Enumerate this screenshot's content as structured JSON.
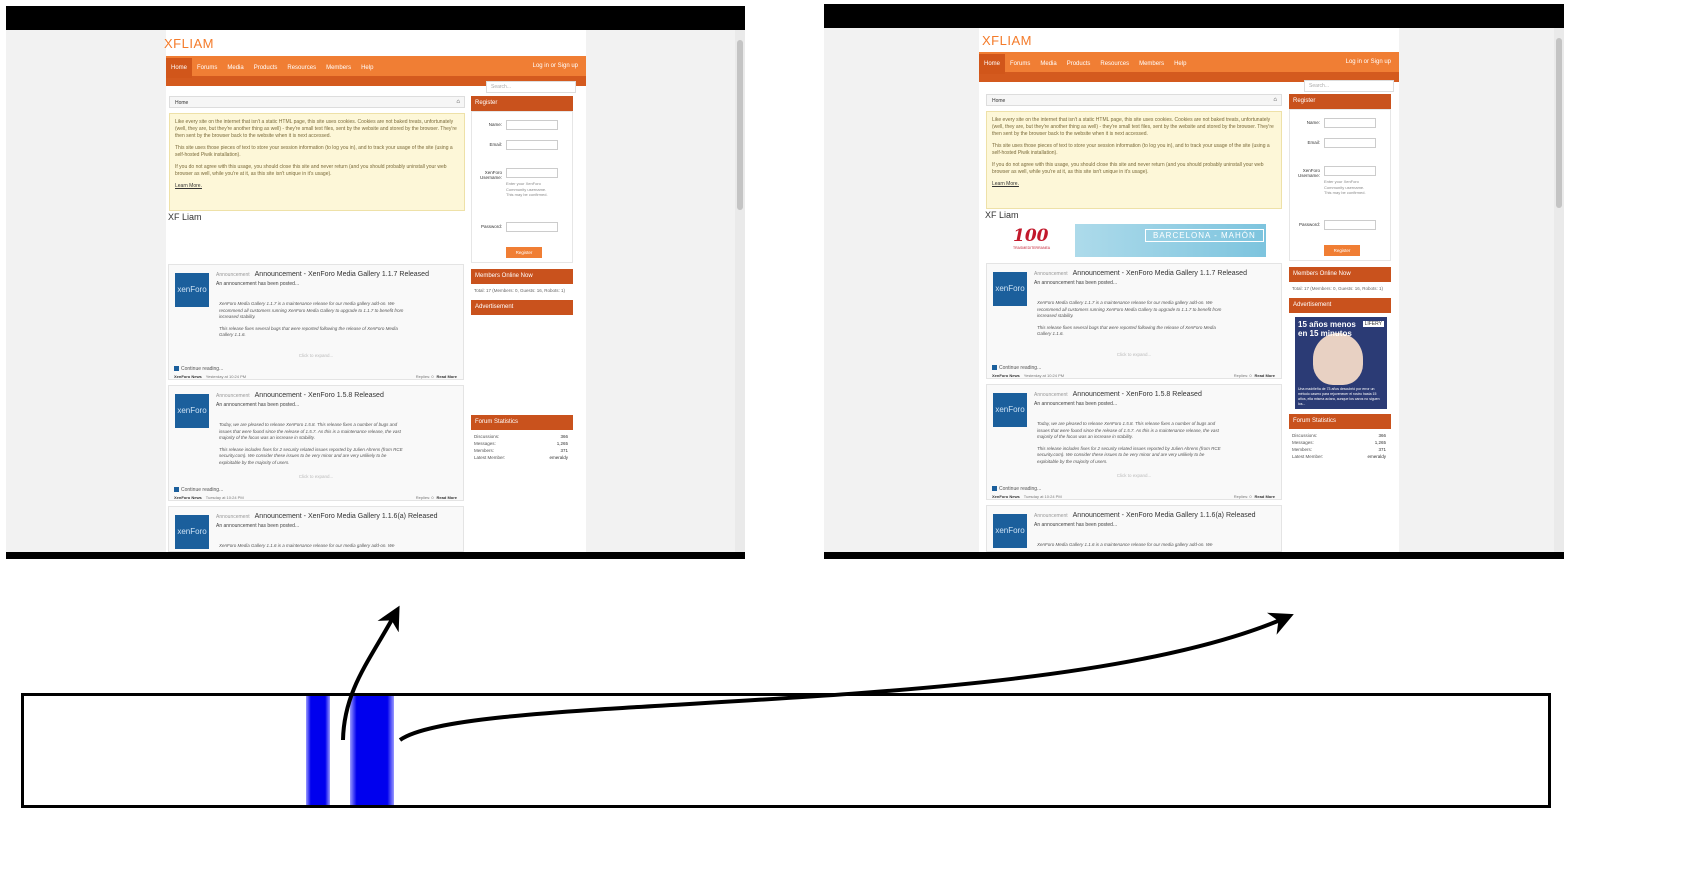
{
  "screenshots": [
    {
      "id": "left",
      "logo": "XFLIAM",
      "nav_tabs": [
        "Home",
        "Forums",
        "Media",
        "Products",
        "Resources",
        "Members",
        "Help"
      ],
      "login": "Log in or Sign up",
      "search_placeholder": "Search...",
      "breadcrumb": "Home",
      "notice": [
        "Like every site on the internet that isn't a static HTML page, this site uses cookies. Cookies are not baked treats, unfortunately (well, they are, but they're another thing as well) - they're small text files, sent by the website and stored by the browser. They're then sent by the browser back to the website when it is next accessed.",
        "This site uses those pieces of text to store your session information (to log you in), and to track your usage of the site (using a self-hosted Piwik installation).",
        "If you do not agree with this usage, you should close this site and never return (and you should probably uninstall your web browser as well, while you're at it, as this site isn't unique in it's usage)."
      ],
      "learn_more": "Learn More.",
      "site_title": "XF Liam",
      "show_banner": false,
      "show_ad": false
    },
    {
      "id": "right",
      "logo": "XFLIAM",
      "nav_tabs": [
        "Home",
        "Forums",
        "Media",
        "Products",
        "Resources",
        "Members",
        "Help"
      ],
      "login": "Log in or Sign up",
      "search_placeholder": "Search...",
      "breadcrumb": "Home",
      "notice": [
        "Like every site on the internet that isn't a static HTML page, this site uses cookies. Cookies are not baked treats, unfortunately (well, they are, but they're another thing as well) - they're small text files, sent by the website and stored by the browser. They're then sent by the browser back to the website when it is next accessed.",
        "This site uses those pieces of text to store your session information (to log you in), and to track your usage of the site (using a self-hosted Piwik installation).",
        "If you do not agree with this usage, you should close this site and never return (and you should probably uninstall your web browser as well, while you're at it, as this site isn't unique in it's usage)."
      ],
      "learn_more": "Learn More.",
      "site_title": "XF Liam",
      "show_banner": true,
      "show_ad": true
    }
  ],
  "posts": [
    {
      "prefix": "Announcement",
      "title": "Announcement - XenForo Media Gallery 1.1.7 Released",
      "sub": "An announcement has been posted...",
      "body": [
        "XenForo Media Gallery 1.1.7 is a maintenance release for our media gallery add-on. We recommend all customers running XenForo Media Gallery to upgrade to 1.1.7 to benefit from increased stability.",
        "This release fixes several bugs that were reported following the release of XenForo Media Gallery 1.1.6."
      ],
      "expand": "Click to expand...",
      "continue": "Continue reading...",
      "author": "XenForo News",
      "time": "Yesterday at 10:24 PM",
      "replies": "Replies: 0",
      "read_more": "Read More"
    },
    {
      "prefix": "Announcement",
      "title": "Announcement - XenForo 1.5.8 Released",
      "sub": "An announcement has been posted...",
      "body": [
        "Today, we are pleased to release XenForo 1.5.8. This release fixes a number of bugs and issues that were found since the release of 1.5.7. As this is a maintenance release, the vast majority of the focus was an increase in stability.",
        "This release includes fixes for 2 security related issues reported by Julien Ahrens (from RCE security.com). We consider these issues to be very minor and are very unlikely to be exploitable by the majority of users."
      ],
      "expand": "Click to expand...",
      "continue": "Continue reading...",
      "author": "XenForo News",
      "time": "Tuesday at 10:24 PM",
      "replies": "Replies: 0",
      "read_more": "Read More"
    },
    {
      "prefix": "Announcement",
      "title": "Announcement - XenForo Media Gallery 1.1.6(a) Released",
      "sub": "An announcement has been posted...",
      "body": [
        "XenForo Media Gallery 1.1.6 is a maintenance release for our media gallery add-on. We"
      ],
      "expand": "",
      "continue": "",
      "author": "",
      "time": "",
      "replies": "",
      "read_more": ""
    }
  ],
  "avatar_text": "xenForo",
  "sidebar": {
    "register_title": "Register",
    "name_label": "Name:",
    "email_label": "Email:",
    "xf_label": "XenForo Username:",
    "xf_hint": "Enter your XenForo Community username. This may be confirmed.",
    "password_label": "Password:",
    "register_button": "Register",
    "online_title": "Members Online Now",
    "online_text": "Total: 17 (Members: 0, Guests: 16, Robots: 1)",
    "ad_title": "Advertisement",
    "stats_title": "Forum Statistics",
    "stats": [
      {
        "label": "Discussions:",
        "value": "366"
      },
      {
        "label": "Messages:",
        "value": "1,265"
      },
      {
        "label": "Members:",
        "value": "371"
      },
      {
        "label": "Latest Member:",
        "value": "emeraldy"
      }
    ]
  },
  "banner": {
    "number": "100",
    "brand": "TRASMEDITERRANEA",
    "destination": "BARCELONA - MAHÓN"
  },
  "side_ad": {
    "headline": "15 años menos en 15 minutos",
    "brand": "LIFERY",
    "text": "Una madrileña de 73 años descubrió por error un método casero para rejuvenecer el rostro hasta 15 años, ella misma aclara, aunque los caros no siguen los..."
  },
  "timeline": {
    "highlighted_segments": 2
  },
  "colors": {
    "accent": "#f07e34",
    "dark_accent": "#c9521d",
    "segment": "#0000ee"
  }
}
